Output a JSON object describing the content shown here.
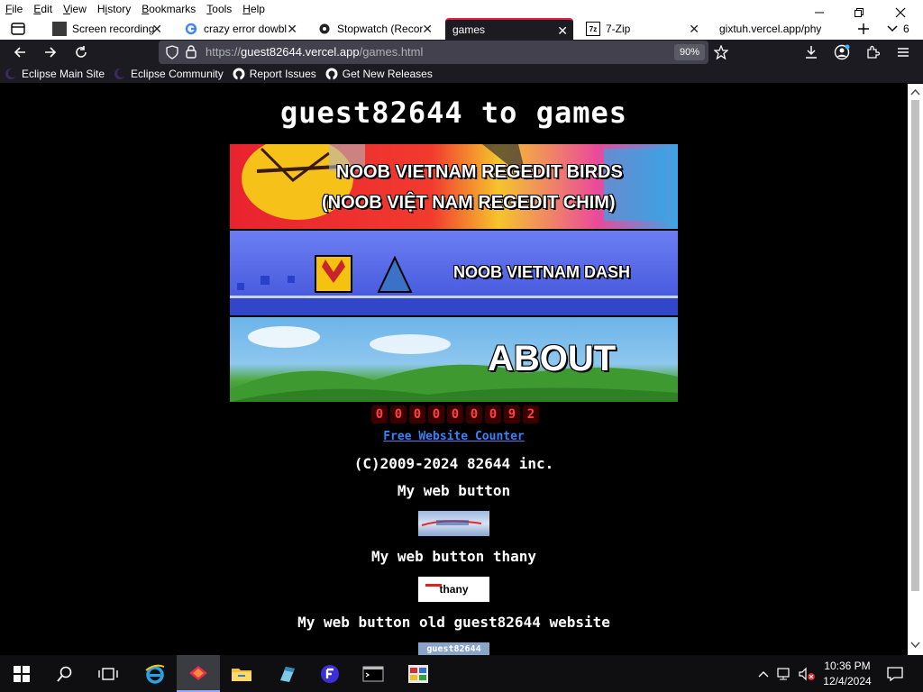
{
  "menu": {
    "items": [
      "File",
      "Edit",
      "View",
      "History",
      "Bookmarks",
      "Tools",
      "Help"
    ],
    "accel": [
      "F",
      "E",
      "V",
      "i",
      "B",
      "T",
      "H"
    ]
  },
  "tabs": [
    {
      "title": "Screen recording",
      "icon": "screen-recording-favicon"
    },
    {
      "title": "crazy error dowbl",
      "icon": "google-icon"
    },
    {
      "title": "Stopwatch (Recor",
      "icon": "stopwatch-favicon"
    },
    {
      "title": "games",
      "icon": "none",
      "active": true
    },
    {
      "title": "7-Zip",
      "icon": "7zip-icon"
    },
    {
      "title": "gixtuh.vercel.app/phy",
      "icon": "none"
    }
  ],
  "tab_count": "6",
  "navbar": {
    "url_prefix": "https://",
    "url_host": "guest82644.vercel.app",
    "url_path": "/games.html",
    "zoom": "90%"
  },
  "bookmarks": [
    {
      "label": "Eclipse Main Site",
      "icon": "eclipse-icon"
    },
    {
      "label": "Eclipse Community",
      "icon": "eclipse-icon"
    },
    {
      "label": "Report Issues",
      "icon": "github-icon"
    },
    {
      "label": "Get New Releases",
      "icon": "github-icon"
    }
  ],
  "page": {
    "title": "guest82644 to games",
    "banners": [
      {
        "line1": "NOOB VIETNAM REGEDIT BIRDS",
        "line2": "(NOOB VIỆT NAM REGEDIT CHIM)"
      },
      {
        "label": "NOOB VIETNAM DASH"
      },
      {
        "label": "ABOUT"
      }
    ],
    "counter_digits": [
      "0",
      "0",
      "0",
      "0",
      "0",
      "0",
      "0",
      "9",
      "2"
    ],
    "counter_link": "Free Website Counter",
    "copyright": "(C)2009-2024 82644 inc.",
    "web_button_heading": "My web button",
    "web_button_thany_heading": "My web button thany",
    "web_button_thany_label": "thany",
    "web_button_old_heading": "My web button old guest82644 website",
    "web_button_old_label": "guest82644"
  },
  "taskbar": {
    "time": "10:36 PM",
    "date": "12/4/2024"
  },
  "colors": {
    "accent": "#e0204a",
    "browser_dark": "#1c1b22",
    "link": "#3b82f6"
  }
}
